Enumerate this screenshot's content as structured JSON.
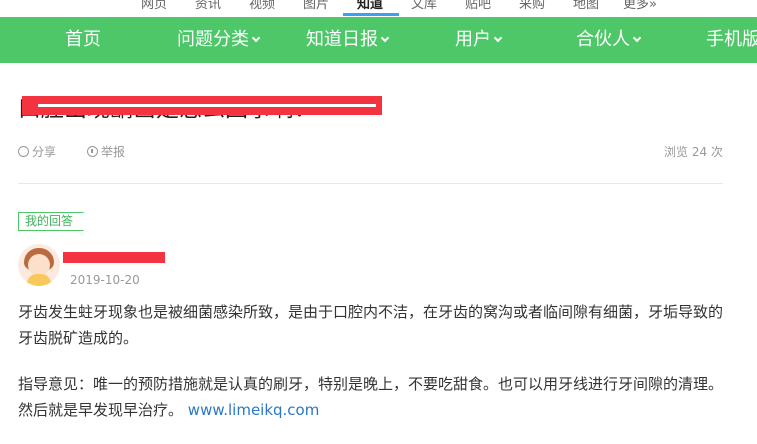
{
  "top_tabs": [
    {
      "label": "网页"
    },
    {
      "label": "资讯"
    },
    {
      "label": "视频"
    },
    {
      "label": "图片"
    },
    {
      "label": "知道",
      "active": true
    },
    {
      "label": "文库"
    },
    {
      "label": "贴吧"
    },
    {
      "label": "采购"
    },
    {
      "label": "地图"
    },
    {
      "label": "更多»"
    }
  ],
  "nav": {
    "bg_color": "#4ec769",
    "items": [
      {
        "label": "首页",
        "has_dropdown": false
      },
      {
        "label": "问题分类",
        "has_dropdown": true
      },
      {
        "label": "知道日报",
        "has_dropdown": true
      },
      {
        "label": "用户",
        "has_dropdown": true
      },
      {
        "label": "合伙人",
        "has_dropdown": true
      },
      {
        "label": "手机版",
        "has_dropdown": false
      }
    ]
  },
  "question": {
    "title": "口腔出现龋齿是怎么回事啊？",
    "share_label": "分享",
    "report_label": "举报",
    "views_label": "浏览 24 次"
  },
  "answer": {
    "tag_label": "我的回答",
    "date": "2019-10-20",
    "para1": "牙齿发生蛀牙现象也是被细菌感染所致，是由于口腔内不洁，在牙齿的窝沟或者临间隙有细菌，牙垢导致的牙齿脱矿造成的。",
    "para2": "指导意见：唯一的预防措施就是认真的刷牙，特别是晚上，不要吃甜食。也可以用牙线进行牙间隙的清理。然后就是早发现早治疗。",
    "link_text": "www.limeikq.com"
  }
}
